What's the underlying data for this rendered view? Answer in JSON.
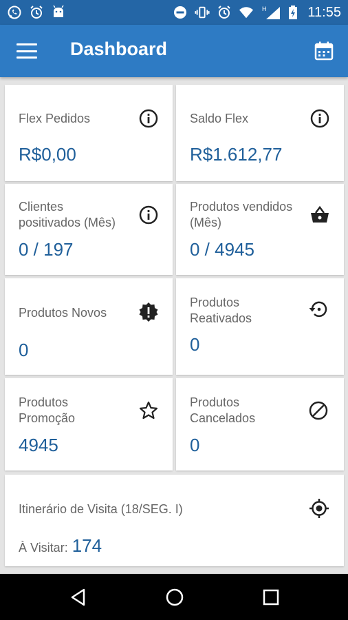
{
  "status_bar": {
    "time": "11:55",
    "left_icons": [
      "whatsapp-icon",
      "alarm-icon",
      "android-icon"
    ],
    "right_icons": [
      "do-not-disturb-icon",
      "vibrate-icon",
      "alarm-icon",
      "wifi-icon",
      "hspa-icon",
      "signal-icon",
      "battery-charging-icon"
    ],
    "network_label": "H"
  },
  "app_bar": {
    "title": "Dashboard",
    "menu_icon": "menu-icon",
    "calendar_icon": "calendar-icon",
    "color": "#2e7bc4"
  },
  "cards": {
    "flex_pedidos": {
      "label": "Flex Pedidos",
      "value": "R$0,00",
      "icon": "info-icon"
    },
    "saldo_flex": {
      "label": "Saldo Flex",
      "value": "R$1.612,77",
      "icon": "info-icon"
    },
    "clientes_positivados": {
      "label_line1": "Clientes",
      "label_line2": "positivados (Mês)",
      "value": "0 / 197",
      "icon": "info-icon"
    },
    "produtos_vendidos": {
      "label_line1": "Produtos vendidos",
      "label_line2": "(Mês)",
      "value": "0 / 4945",
      "icon": "basket-icon"
    },
    "produtos_novos": {
      "label": "Produtos Novos",
      "value": "0",
      "icon": "new-badge-icon"
    },
    "produtos_reativados": {
      "label_line1": "Produtos",
      "label_line2": "Reativados",
      "value": "0",
      "icon": "restore-icon"
    },
    "produtos_promocao": {
      "label_line1": "Produtos",
      "label_line2": "Promoção",
      "value": "4945",
      "icon": "star-icon"
    },
    "produtos_cancelados": {
      "label_line1": "Produtos",
      "label_line2": "Cancelados",
      "value": "0",
      "icon": "block-icon"
    },
    "itinerario": {
      "label": "Itinerário de Visita (18/SEG. I)",
      "visit_label": "À Visitar:",
      "visit_value": "174",
      "icon": "gps-target-icon"
    }
  },
  "colors": {
    "value_blue": "#1f5f9a",
    "label_gray": "#666666",
    "background": "#e4e4e4"
  },
  "nav_bar": {
    "icons": [
      "back-icon",
      "home-icon",
      "recents-icon"
    ]
  }
}
